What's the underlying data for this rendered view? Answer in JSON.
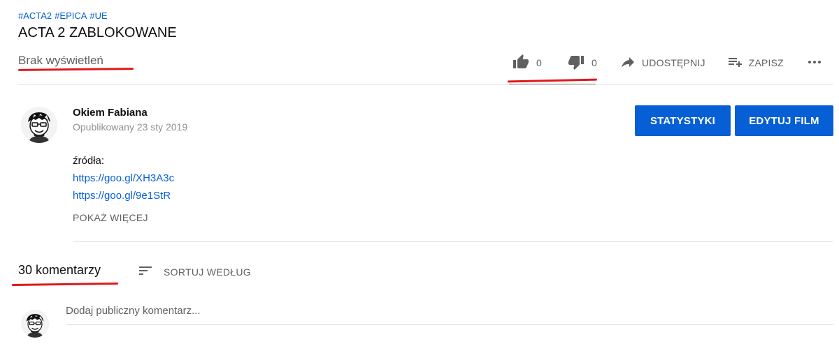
{
  "hashtags": [
    "#ACTA2",
    "#EPICA",
    "#UE"
  ],
  "title": "ACTA 2 ZABLOKOWANE",
  "views": "Brak wyświetleń",
  "actions": {
    "like_count": "0",
    "dislike_count": "0",
    "share_label": "UDOSTĘPNIJ",
    "save_label": "ZAPISZ"
  },
  "owner": {
    "name": "Okiem Fabiana",
    "published": "Opublikowany 23 sty 2019"
  },
  "buttons": {
    "stats": "STATYSTYKI",
    "edit": "EDYTUJ FILM"
  },
  "description": {
    "label": "źródła:",
    "links": [
      "https://goo.gl/XH3A3c",
      "https://goo.gl/9e1StR"
    ],
    "show_more": "POKAŻ WIĘCEJ"
  },
  "comments": {
    "count": "30 komentarzy",
    "sort_label": "SORTUJ WEDŁUG",
    "placeholder": "Dodaj publiczny komentarz..."
  },
  "colors": {
    "accent": "#065fd4",
    "annotation": "#e0181c"
  },
  "icons": [
    "thumb-up-icon",
    "thumb-down-icon",
    "share-icon",
    "playlist-add-icon",
    "more-icon",
    "sort-icon"
  ]
}
